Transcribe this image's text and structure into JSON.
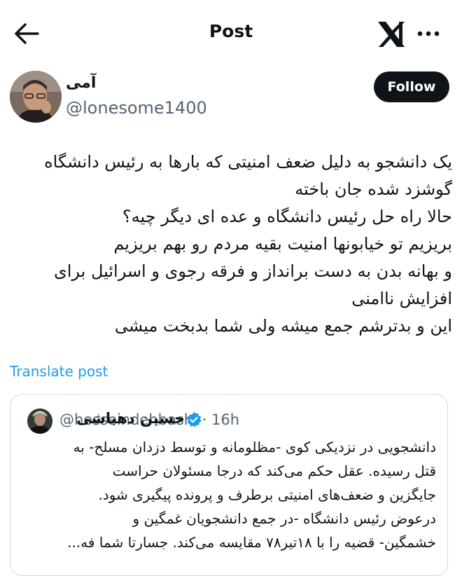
{
  "header": {
    "title": "Post",
    "back_icon": "arrow-left-icon",
    "brand_icon": "x-logo-icon",
    "more_icon": "more-horizontal-icon"
  },
  "post": {
    "author_name": "آمی",
    "author_handle": "@lonesome1400",
    "follow_label": "Follow",
    "lines": [
      "یک دانشجو به دلیل ضعف امنیتی که بارها به رئیس دانشگاه",
      "گوشزد شده جان باخته",
      "حالا راه حل رئیس دانشگاه و عده ای دیگر چیه؟",
      "بریزیم تو خیابونها امنیت بقیه مردم رو بهم بریزیم",
      "و بهانه بدن به دست برانداز و فرقه رجوی و اسرائیل برای",
      "افزایش ناامنی",
      "این و بدترشم جمع میشه ولی شما بدبخت میشی"
    ],
    "translate_label": "Translate post"
  },
  "quoted": {
    "author_name": "حسین دهباشی",
    "handle_time": "@hosseindehbashi · 16h",
    "verified_icon": "verified-badge-icon",
    "lines": [
      "دانشجویی در نزدیکی کوی -مظلومانه و توسط دزدان مسلح- به",
      "قتل رسیده. عقل حکم می‌کند که درجا مسئولان حراست",
      "جایگزین و ضعف‌های امنیتی برطرف و پرونده پیگیری شود.",
      "درعوض رئیس دانشگاه -در جمع دانشجویان غمگین و",
      "خشمگین- قضیه را با ۱۸تیر۷۸ مقایسه می‌کند. جسارتا شما فه..."
    ]
  },
  "colors": {
    "text": "#0f1419",
    "secondary": "#536471",
    "link": "#1d9bf0",
    "follow_bg": "#0f1419",
    "border": "#cfd9de"
  }
}
